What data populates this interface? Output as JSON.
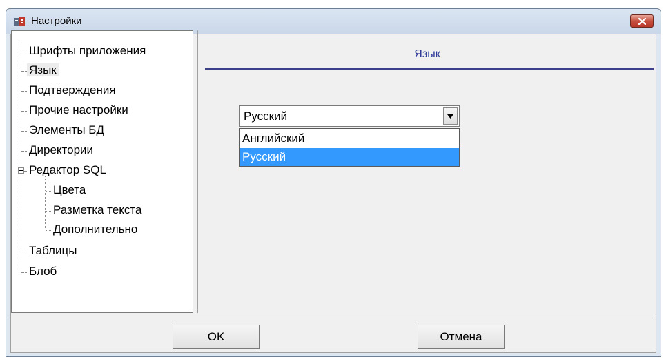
{
  "window": {
    "title": "Настройки"
  },
  "tree": {
    "items": [
      {
        "label": "Шрифты приложения"
      },
      {
        "label": "Язык"
      },
      {
        "label": "Подтверждения"
      },
      {
        "label": "Прочие настройки"
      },
      {
        "label": "Элементы БД"
      },
      {
        "label": "Директории"
      },
      {
        "label": "Редактор SQL"
      },
      {
        "label": "Цвета"
      },
      {
        "label": "Разметка текста"
      },
      {
        "label": "Дополнительно"
      },
      {
        "label": "Таблицы"
      },
      {
        "label": "Блоб"
      }
    ],
    "selected": "Язык"
  },
  "panel": {
    "title": "Язык"
  },
  "language": {
    "current": "Русский",
    "options": [
      "Английский",
      "Русский"
    ],
    "highlighted": "Русский"
  },
  "buttons": {
    "ok": "OK",
    "cancel": "Отмена"
  },
  "colors": {
    "highlight": "#3399ff",
    "panel_title": "#2e3a9a",
    "close_button": "#c75040"
  },
  "icons": {
    "app": "settings-app-icon",
    "close": "close-icon",
    "dropdown": "chevron-down-icon"
  }
}
